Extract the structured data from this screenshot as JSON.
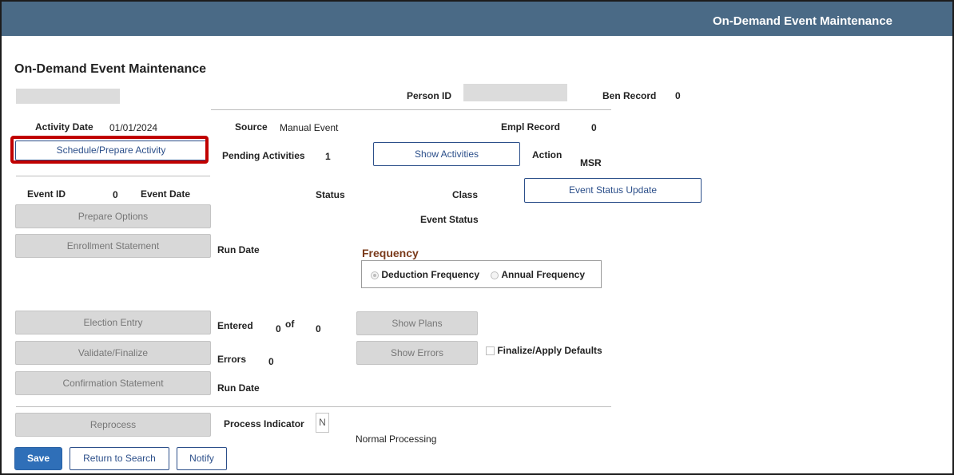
{
  "header": {
    "title": "On-Demand Event Maintenance"
  },
  "page": {
    "title": "On-Demand Event Maintenance"
  },
  "person": {
    "person_id_label": "Person ID",
    "ben_record_label": "Ben Record",
    "ben_record_value": "0"
  },
  "activity": {
    "date_label": "Activity Date",
    "date_value": "01/01/2024",
    "source_label": "Source",
    "source_value": "Manual Event",
    "empl_record_label": "Empl Record",
    "empl_record_value": "0",
    "schedule_button": "Schedule/Prepare Activity",
    "pending_label": "Pending Activities",
    "pending_value": "1",
    "show_activities_button": "Show Activities",
    "action_label": "Action",
    "action_value": "MSR"
  },
  "event": {
    "event_id_label": "Event ID",
    "event_id_value": "0",
    "event_date_label": "Event Date",
    "status_label": "Status",
    "class_label": "Class",
    "status_update_button": "Event Status Update",
    "event_status_label": "Event Status"
  },
  "buttons": {
    "prepare_options": "Prepare Options",
    "enrollment_statement": "Enrollment Statement",
    "election_entry": "Election Entry",
    "validate_finalize": "Validate/Finalize",
    "confirmation_statement": "Confirmation Statement",
    "reprocess": "Reprocess",
    "show_plans": "Show Plans",
    "show_errors": "Show Errors"
  },
  "labels": {
    "run_date_1": "Run Date",
    "run_date_2": "Run Date",
    "entered": "Entered",
    "entered_value": "0",
    "of": "of",
    "of_value": "0",
    "errors": "Errors",
    "errors_value": "0",
    "finalize_defaults": "Finalize/Apply Defaults"
  },
  "frequency": {
    "title": "Frequency",
    "options": [
      "Deduction Frequency",
      "Annual Frequency"
    ],
    "selected": "Deduction Frequency"
  },
  "process": {
    "indicator_label": "Process Indicator",
    "indicator_value": "N",
    "description": "Normal Processing"
  },
  "footer": {
    "save": "Save",
    "return_to_search": "Return to Search",
    "notify": "Notify"
  },
  "colors": {
    "header_bar": "#4a6a86",
    "link_button": "#2c4f8a",
    "primary_button": "#2f6fb8",
    "highlight": "#c00000",
    "frequency_title": "#7a3a1a"
  }
}
